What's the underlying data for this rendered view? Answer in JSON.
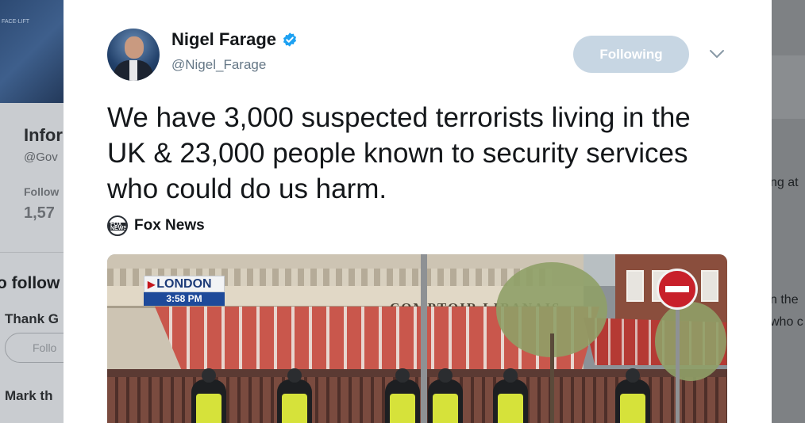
{
  "background_page": {
    "banner_text": "FACE-LIFT",
    "profile_name": "Infor",
    "profile_handle": "@Gov",
    "follow_label": "Follow",
    "follow_count": "1,57",
    "who_to_follow": "o follow",
    "thank_text": "Thank G",
    "follow_button": "Follo",
    "mark_text": "Mark th",
    "right_fragments": [
      "ng at",
      "n the",
      "who c"
    ]
  },
  "tweet": {
    "display_name": "Nigel Farage",
    "handle": "@Nigel_Farage",
    "following_button": "Following",
    "text": "We have 3,000 suspected terrorists living in the UK & 23,000 people known to security services who could do us harm.",
    "source": {
      "icon_text": "FOX NEWS",
      "name": "Fox News"
    },
    "media": {
      "location": "LONDON",
      "time": "3:58 PM",
      "building_sign": "COMPTOIR LIBANAIS"
    }
  },
  "colors": {
    "following_bg": "#c7d6e3",
    "verified": "#1da1f2",
    "text_primary": "#14171a",
    "text_secondary": "#657786",
    "news_blue": "#1e4a9a"
  },
  "icons": {
    "verified": "verified-badge-icon",
    "chevron": "chevron-down-icon",
    "source": "fox-news-icon"
  }
}
